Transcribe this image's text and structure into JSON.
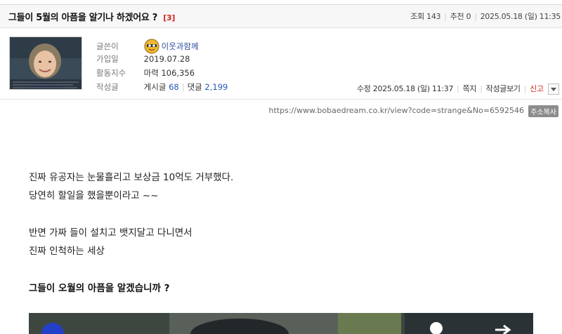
{
  "post": {
    "title": "그들이 5월의 아픔을 알기나 하겠어요 ?",
    "comment_count": "[3]",
    "views_label": "조회",
    "views": "143",
    "recommend_label": "추천",
    "recommend": "0",
    "date": "2025.05.18 (일) 11:35"
  },
  "author": {
    "writer_label": "글쓴이",
    "nickname": "이웃과함께",
    "joined_label": "가입일",
    "joined": "2019.07.28",
    "activity_label": "활동지수",
    "activity_value": "마력 106,356",
    "posts_label": "작성글",
    "posts_prefix": "게시글",
    "posts_count": "68",
    "comments_prefix": "댓글",
    "comments_count": "2,199"
  },
  "actions": {
    "edited": "수정 2025.05.18 (일) 11:37",
    "message": "쪽지",
    "view_posts": "작성글보기",
    "report": "신고"
  },
  "url": {
    "text": "https://www.bobaedream.co.kr/view?code=strange&No=6592546",
    "copy_label": "주소복사"
  },
  "body": {
    "line1": "진짜 유공자는 눈물흘리고 보상금 10억도 거부했다.",
    "line2": "당연히 할일을 했을뿐이라고 ~~",
    "line3": "반면 가짜 들이 설치고 뱃지달고 다니면서",
    "line4": "진짜 인척하는 세상",
    "line5": "그들이 오월의 아픔을 알겠습니까 ?"
  },
  "colors": {
    "accent_red": "#d0271c",
    "link_blue": "#2457b8"
  }
}
